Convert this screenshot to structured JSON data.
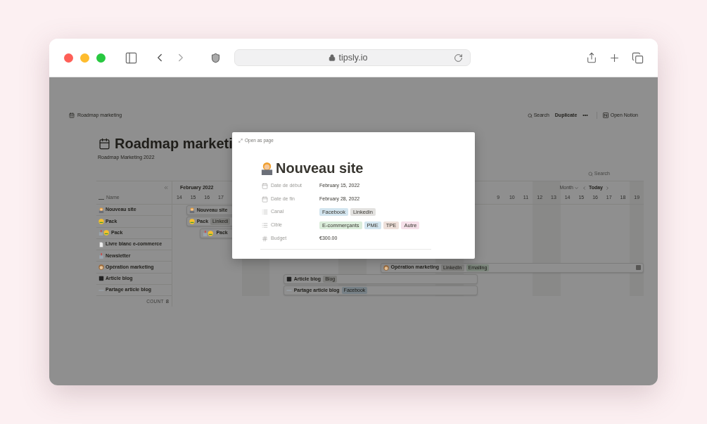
{
  "browser": {
    "url": "tipsly.io"
  },
  "topbar": {
    "breadcrumb": "Roadmap marketing",
    "actions": [
      {
        "label": "Search",
        "kind": "search"
      },
      {
        "label": "Duplicate",
        "kind": "text"
      },
      {
        "label": "•••",
        "kind": "text"
      },
      {
        "label": "Open Notion",
        "kind": "notion"
      }
    ]
  },
  "page": {
    "title": "Roadmap marketi",
    "subtitle": "Roadmap Marketing 2022"
  },
  "view": {
    "search": "Search",
    "period": "Month",
    "today": "Today"
  },
  "gantt": {
    "name_header": "Name",
    "month": "February 2022",
    "days_start": [
      "14",
      "15",
      "16",
      "17"
    ],
    "days_end": [
      "9",
      "10",
      "11",
      "12",
      "13",
      "14",
      "15",
      "16",
      "17",
      "18",
      "19"
    ],
    "rows": [
      {
        "name": "Nouveau site",
        "bar": {
          "title": "Nouveau site"
        }
      },
      {
        "name": "Pack",
        "bar": {
          "title": "Pack",
          "tags": [
            {
              "label": "Linkedi",
              "color": "#7f7f7d"
            }
          ]
        }
      },
      {
        "name": "Pack",
        "bar": {
          "title": "Pack"
        }
      },
      {
        "name": "Livre blanc e-commerce"
      },
      {
        "name": "Newsletter"
      },
      {
        "name": "Opération marketing",
        "bar": {
          "title": "Opération marketing",
          "tags": [
            {
              "label": "LinkedIn",
              "color": "#7f7f7d"
            },
            {
              "label": "Emailing",
              "color": "#7b857b"
            }
          ]
        }
      },
      {
        "name": "Article blog",
        "bar": {
          "title": "Article blog",
          "tags": [
            {
              "label": "Blog",
              "color": "#7f7f7d"
            }
          ]
        }
      },
      {
        "name": "Partage article blog",
        "bar": {
          "title": "Partage article blog",
          "tags": [
            {
              "label": "Facebook",
              "color": "#768086"
            }
          ]
        }
      }
    ],
    "count_label": "COUNT",
    "count": "8"
  },
  "modal": {
    "open_label": "Open as page",
    "title": "Nouveau site",
    "properties": [
      {
        "label": "Date de début",
        "kind": "date",
        "value": "February 15, 2022"
      },
      {
        "label": "Date de fin",
        "kind": "date",
        "value": "February 28, 2022"
      },
      {
        "label": "Canal",
        "kind": "multi",
        "tags": [
          {
            "label": "Facebook",
            "color": "#d3e5ef"
          },
          {
            "label": "Linkedin",
            "color": "#e3e2e0"
          }
        ]
      },
      {
        "label": "Cible",
        "kind": "multi",
        "tags": [
          {
            "label": "E-commerçants",
            "color": "#dbeddb"
          },
          {
            "label": "PME",
            "color": "#d3e5ef"
          },
          {
            "label": "TPE",
            "color": "#eee0da"
          },
          {
            "label": "Autre",
            "color": "#f5e0e9"
          }
        ]
      },
      {
        "label": "Budget",
        "kind": "number",
        "value": "€300.00"
      }
    ]
  }
}
